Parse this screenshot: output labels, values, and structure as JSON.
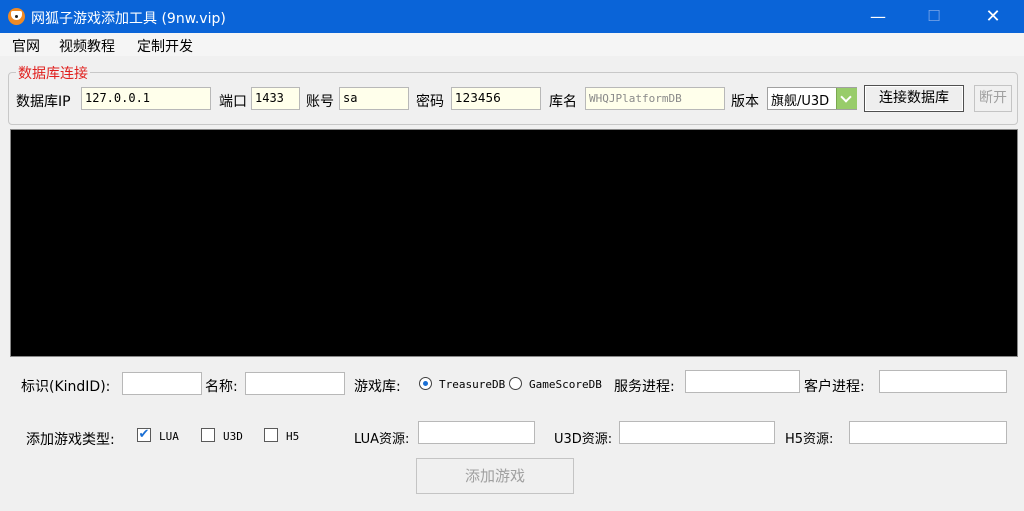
{
  "window": {
    "title": "网狐子游戏添加工具 (9nw.vip)",
    "minimize": "—",
    "maximize": "☐",
    "close": "✕"
  },
  "menu": {
    "items": [
      "官网",
      "视频教程",
      "定制开发"
    ]
  },
  "db": {
    "legend": "数据库连接",
    "ip_label": "数据库IP",
    "ip_value": "127.0.0.1",
    "port_label": "端口",
    "port_value": "1433",
    "account_label": "账号",
    "account_value": "sa",
    "password_label": "密码",
    "password_value": "123456",
    "dbname_label": "库名",
    "dbname_placeholder": "WHQJPlatformDB",
    "version_label": "版本",
    "version_value": "旗舰/U3D",
    "connect_label": "连接数据库",
    "disconnect_label": "断开"
  },
  "form": {
    "kindid_label": "标识(KindID):",
    "kindid_value": "",
    "name_label": "名称:",
    "name_value": "",
    "gamedb_label": "游戏库:",
    "gamedb_options": [
      "TreasureDB",
      "GameScoreDB"
    ],
    "gamedb_selected": "TreasureDB",
    "server_process_label": "服务进程:",
    "server_process_value": "",
    "client_process_label": "客户进程:",
    "client_process_value": "",
    "type_label": "添加游戏类型:",
    "types": [
      {
        "label": "LUA",
        "checked": true
      },
      {
        "label": "U3D",
        "checked": false
      },
      {
        "label": "H5",
        "checked": false
      }
    ],
    "lua_res_label": "LUA资源:",
    "u3d_res_label": "U3D资源:",
    "h5_res_label": "H5资源:",
    "add_button_label": "添加游戏"
  },
  "colors": {
    "titlebar": "#0a64d8",
    "legend": "#e0201e",
    "yellow_field": "#ffffeb",
    "log_background": "#000000"
  }
}
